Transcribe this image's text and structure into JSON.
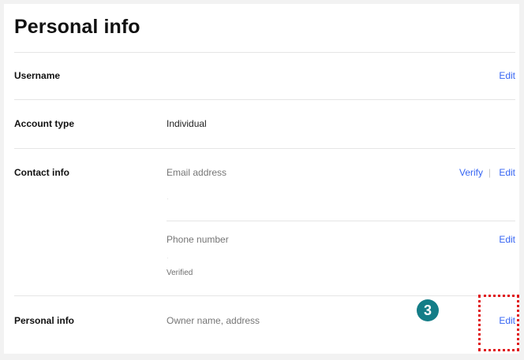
{
  "page": {
    "title": "Personal info"
  },
  "rows": {
    "username": {
      "label": "Username",
      "edit_label": "Edit"
    },
    "account_type": {
      "label": "Account type",
      "value": "Individual"
    },
    "contact_info": {
      "label": "Contact info",
      "email_label": "Email address",
      "verify_label": "Verify",
      "separator": "|",
      "email_edit_label": "Edit",
      "phone_label": "Phone number",
      "phone_edit_label": "Edit",
      "phone_status": "Verified"
    },
    "personal_info": {
      "label": "Personal info",
      "value": "Owner name, address",
      "edit_label": "Edit"
    }
  },
  "annotation": {
    "step_number": "3",
    "badge_color": "#147d87",
    "highlight_color": "#e0181b"
  },
  "colors": {
    "link": "#3665f3",
    "background": "#f2f2f2",
    "card": "#ffffff"
  }
}
